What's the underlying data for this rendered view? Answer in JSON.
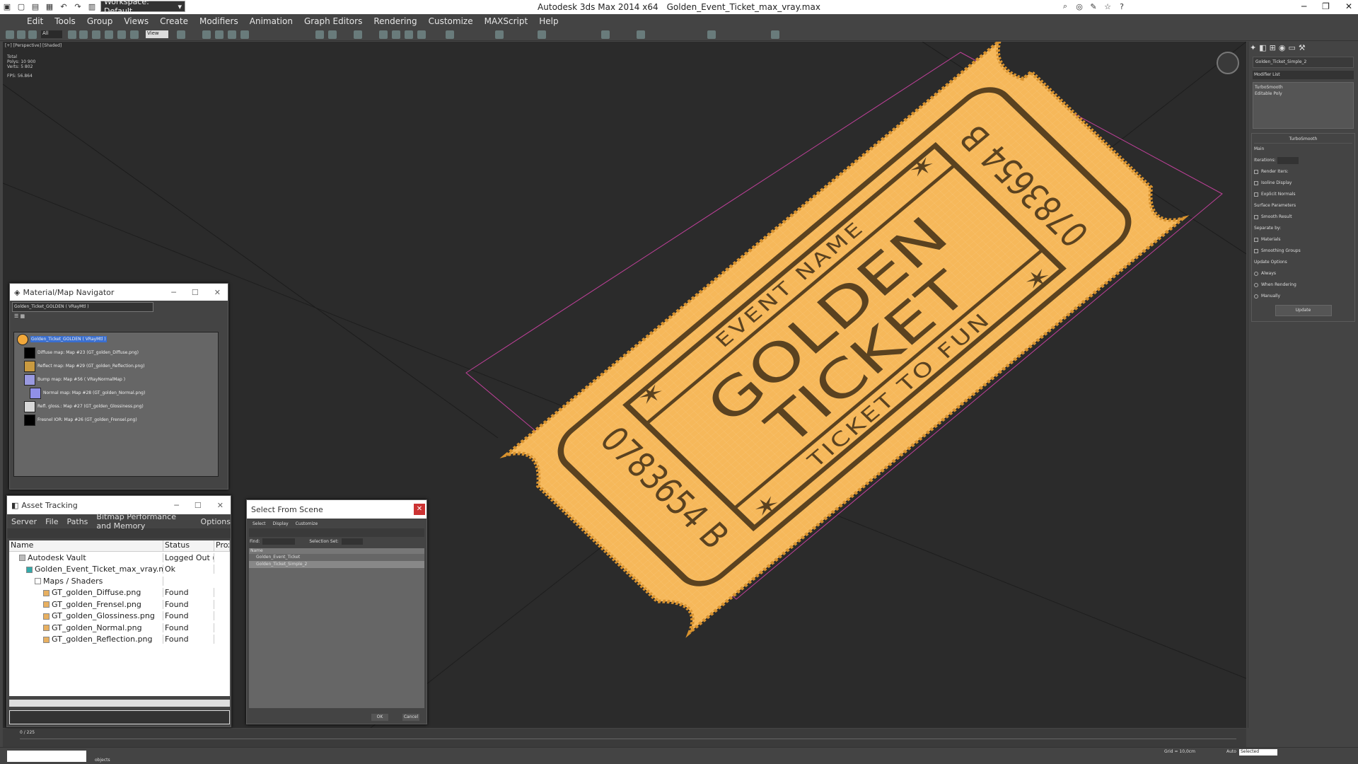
{
  "titlebar": {
    "workspace": "Workspace: Default",
    "app": "Autodesk 3ds Max  2014 x64",
    "file": "Golden_Event_Ticket_max_vray.max"
  },
  "menu": [
    "Edit",
    "Tools",
    "Group",
    "Views",
    "Create",
    "Modifiers",
    "Animation",
    "Graph Editors",
    "Rendering",
    "Customize",
    "MAXScript",
    "Help"
  ],
  "toolbar": {
    "selection_filter": "All",
    "view": "View"
  },
  "viewport": {
    "label": "[+] [Perspective] [Shaded]",
    "stats": {
      "total": "Total",
      "polys": "Polys:  10 900",
      "verts": "Verts:   5 802",
      "fps": "FPS:    56.864"
    },
    "ticket": {
      "top": "EVENT NAME",
      "main1": "GOLDEN",
      "main2": "TICKET",
      "bottom": "TICKET TO FUN",
      "serial": "0783654 B",
      "fill": "#f6b85a",
      "ink": "#5a4220"
    }
  },
  "command_panel": {
    "object_name": "Golden_Ticket_Simple_2",
    "modifier_list": "Modifier List",
    "stack": [
      "TurboSmooth",
      "Editable Poly"
    ],
    "turbosmooth": {
      "title": "TurboSmooth",
      "main": "Main",
      "iterations": "Iterations:",
      "render_iters": "Render Iters:",
      "isoline": "Isoline Display",
      "explicit": "Explicit Normals",
      "surface": "Surface Parameters",
      "smooth_result": "Smooth Result",
      "separate_by": "Separate by:",
      "materials": "Materials",
      "smoothing_groups": "Smoothing Groups",
      "update_options": "Update Options",
      "always": "Always",
      "when_rendering": "When Rendering",
      "manually": "Manually",
      "update": "Update"
    }
  },
  "material_nav": {
    "title": "Material/Map Navigator",
    "input": "Golden_Ticket_GOLDEN  ( VRayMtl )",
    "items": [
      {
        "label": "Golden_Ticket_GOLDEN  ( VRayMtl )",
        "color": "#f2a83a"
      },
      {
        "label": "Diffuse map: Map #23 (GT_golden_Diffuse.png)",
        "color": "#000000"
      },
      {
        "label": "Reflect map: Map #29 (GT_golden_Reflection.png)",
        "color": "#c99a40"
      },
      {
        "label": "Bump map: Map #56  ( VRayNormalMap )",
        "color": "#9a9ae0"
      },
      {
        "label": "Normal map: Map #28 (GT_golden_Normal.png)",
        "color": "#9090e8"
      },
      {
        "label": "Refl. gloss.: Map #27 (GT_golden_Glossiness.png)",
        "color": "#d8d8d8"
      },
      {
        "label": "Fresnel IOR: Map #26 (GT_golden_Frensel.png)",
        "color": "#000000"
      }
    ]
  },
  "asset_tracking": {
    "title": "Asset Tracking",
    "menu": [
      "Server",
      "File",
      "Paths",
      "Bitmap Performance and Memory",
      "Options"
    ],
    "columns": [
      "Name",
      "Status",
      "Prox"
    ],
    "rows": [
      {
        "name": "Autodesk Vault",
        "status": "Logged Out (...",
        "indent": 0
      },
      {
        "name": "Golden_Event_Ticket_max_vray.max",
        "status": "Ok",
        "indent": 1
      },
      {
        "name": "Maps / Shaders",
        "status": "",
        "indent": 2
      },
      {
        "name": "GT_golden_Diffuse.png",
        "status": "Found",
        "indent": 3
      },
      {
        "name": "GT_golden_Frensel.png",
        "status": "Found",
        "indent": 3
      },
      {
        "name": "GT_golden_Glossiness.png",
        "status": "Found",
        "indent": 3
      },
      {
        "name": "GT_golden_Normal.png",
        "status": "Found",
        "indent": 3
      },
      {
        "name": "GT_golden_Reflection.png",
        "status": "Found",
        "indent": 3
      }
    ]
  },
  "select_scene": {
    "title": "Select From Scene",
    "menu": [
      "Select",
      "Display",
      "Customize"
    ],
    "find": "Find:",
    "selection_set": "Selection Set:",
    "col_name": "Name",
    "items": [
      "Golden_Event_Ticket",
      "Golden_Ticket_Simple_2"
    ],
    "ok": "OK",
    "cancel": "Cancel"
  },
  "timeline": {
    "frame": "0 / 225"
  },
  "status": {
    "text": "objects",
    "selected": "Selected",
    "grid": "Grid = 10,0cm",
    "auto": "Auto"
  }
}
